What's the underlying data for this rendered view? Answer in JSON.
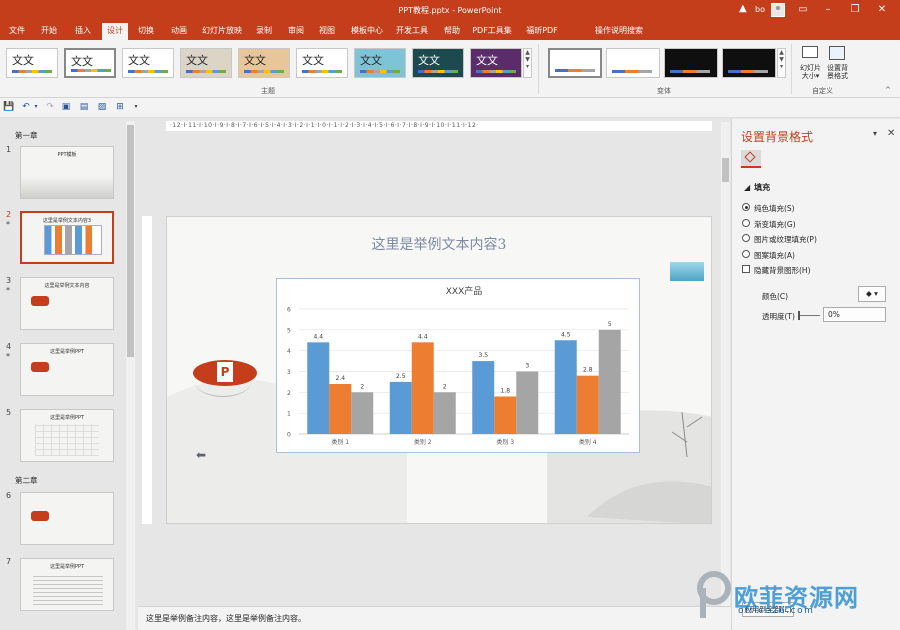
{
  "window": {
    "title": "PPT教程.pptx  -  PowerPoint",
    "user": "bo",
    "minimize": "–",
    "restore": "❐",
    "close": "✕",
    "warn": "▲"
  },
  "tabs": [
    {
      "label": "文件",
      "active": false
    },
    {
      "label": "开始",
      "active": false
    },
    {
      "label": "插入",
      "active": false
    },
    {
      "label": "设计",
      "active": true
    },
    {
      "label": "切换",
      "active": false
    },
    {
      "label": "动画",
      "active": false
    },
    {
      "label": "幻灯片放映",
      "active": false
    },
    {
      "label": "录制",
      "active": false
    },
    {
      "label": "审阅",
      "active": false
    },
    {
      "label": "视图",
      "active": false
    },
    {
      "label": "模板中心",
      "active": false
    },
    {
      "label": "开发工具",
      "active": false
    },
    {
      "label": "帮助",
      "active": false
    },
    {
      "label": "PDF工具集",
      "active": false
    },
    {
      "label": "福昕PDF",
      "active": false
    },
    {
      "label": "操作说明搜索",
      "active": false
    }
  ],
  "ribbon": {
    "themes_label": "主题",
    "variants_label": "变体",
    "customize_label": "自定义",
    "theme_text": "文文",
    "theme_text_alt": "文文",
    "slide_size": [
      "幻灯片",
      "大小▾"
    ],
    "bg_format": [
      "设置背",
      "景格式"
    ],
    "theme_colors": [
      "#ffffff",
      "#ffffff",
      "#ffffff",
      "#dcd4c4",
      "#e7c69a",
      "#ffffff",
      "#7ec4d6",
      "#1d4a4f",
      "#5a2d6a"
    ],
    "variant_colors": [
      "#ffffff",
      "#ffffff",
      "#0f0f0f",
      "#0f0f0f"
    ]
  },
  "thumbs": {
    "section1": "第一章",
    "section2": "第二章",
    "slides": [
      {
        "num": "1",
        "title": "PPT模板",
        "star": false
      },
      {
        "num": "2",
        "title": "这里是举例文本内容3",
        "star": true
      },
      {
        "num": "3",
        "title": "这里是举例文本内容",
        "star": true
      },
      {
        "num": "4",
        "title": "这里是举例PPT",
        "star": true
      },
      {
        "num": "5",
        "title": "这里是举例PPT",
        "star": false
      },
      {
        "num": "6",
        "title": "",
        "star": false
      },
      {
        "num": "7",
        "title": "这里是举例PPT",
        "star": false
      }
    ],
    "star_char": "*"
  },
  "ruler": {
    "h_labels": "·12·I·11·I·10·I·9·I·8·I·7·I·6·I·5·I·4·I·3·I·2·I·1·I·0·I·1·I·2·I·3·I·4·I·5·I·6·I·7·I·8·I·9·I·10·I·11·I·12·"
  },
  "slide": {
    "title": "这里是举例文本内容3",
    "back_arrow": "⬅",
    "ppt_logo": "P"
  },
  "chart_data": {
    "type": "bar",
    "title": "XXX产品",
    "categories": [
      "类别 1",
      "类别 2",
      "类别 3",
      "类别 4"
    ],
    "series": [
      {
        "values": [
          4.4,
          2.5,
          3.5,
          4.5
        ],
        "color": "#5b9bd5"
      },
      {
        "values": [
          2.4,
          4.4,
          1.8,
          2.8
        ],
        "color": "#ed7d31"
      },
      {
        "values": [
          2,
          2,
          3,
          5
        ],
        "color": "#a5a5a5"
      }
    ],
    "ylim": [
      0,
      6
    ],
    "yticks": [
      0,
      1,
      2,
      3,
      4,
      5,
      6
    ],
    "grid": true
  },
  "notes": {
    "text": "这里是举例备注内容，这里是举例备注内容。"
  },
  "pane": {
    "title": "设置背景格式",
    "fill_header": "填充",
    "options": [
      {
        "label": "纯色填充(S)",
        "type": "radio",
        "checked": true
      },
      {
        "label": "渐变填充(G)",
        "type": "radio",
        "checked": false
      },
      {
        "label": "图片或纹理填充(P)",
        "type": "radio",
        "checked": false
      },
      {
        "label": "图案填充(A)",
        "type": "radio",
        "checked": false
      },
      {
        "label": "隐藏背景图形(H)",
        "type": "check",
        "checked": false
      }
    ],
    "color_label": "颜色(C)",
    "transparency_label": "透明度(T)",
    "transparency_value": "0%",
    "apply_all": "应用到全部(L)"
  },
  "watermark": {
    "name": "欧菲资源网",
    "domain": "office26.com"
  }
}
